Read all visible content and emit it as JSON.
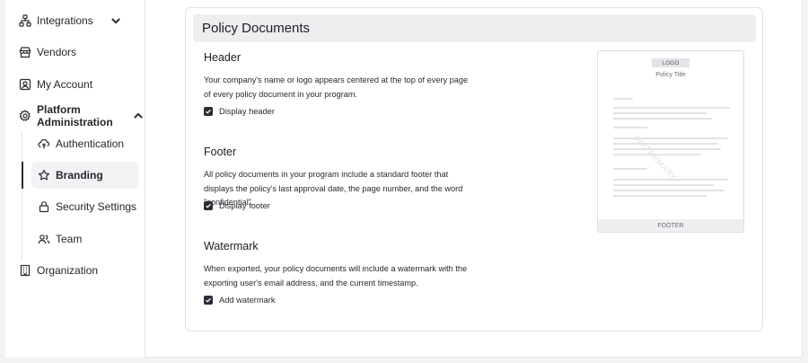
{
  "sidebar": {
    "items": [
      {
        "label": "Integrations",
        "icon": "hierarchy-icon"
      },
      {
        "label": "Vendors",
        "icon": "storefront-icon"
      },
      {
        "label": "My Account",
        "icon": "account-icon"
      },
      {
        "label": "Platform Administration",
        "icon": "gear-icon"
      },
      {
        "label": "Organization",
        "icon": "building-icon"
      }
    ],
    "subitems": [
      {
        "label": "Authentication",
        "icon": "cloud-key-icon"
      },
      {
        "label": "Branding",
        "icon": "star-icon"
      },
      {
        "label": "Security Settings",
        "icon": "lock-icon"
      },
      {
        "label": "Team",
        "icon": "team-icon"
      }
    ]
  },
  "main": {
    "title": "Policy Documents",
    "sections": [
      {
        "title": "Header",
        "text": "Your company's name or logo appears centered at the top of every page of every policy document in your program.",
        "checkbox_label": "Display header",
        "checked": true
      },
      {
        "title": "Footer",
        "text": "All policy documents in your program include a standard footer that displays the policy's last approval date, the page number, and the word \"confidential\".",
        "checkbox_label": "Display footer",
        "checked": true
      },
      {
        "title": "Watermark",
        "text": "When exported, your policy documents will include a watermark with the exporting user's email address, and the current timestamp.",
        "checkbox_label": "Add watermark",
        "checked": true
      }
    ],
    "preview": {
      "logo": "LOGO",
      "policy_title": "Policy Title",
      "watermark": "WATERMARK",
      "footer": "FOOTER"
    }
  },
  "colors": {
    "accent": "#2c2c36",
    "header_bg": "#eeeef1",
    "active_bg": "#f2f2f4"
  }
}
